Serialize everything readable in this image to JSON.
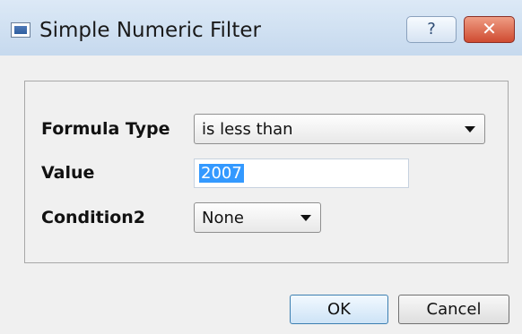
{
  "window": {
    "title": "Simple Numeric Filter"
  },
  "title_buttons": {
    "help": "?",
    "close": "✕"
  },
  "form": {
    "formula_type": {
      "label": "Formula Type",
      "value": "is less than"
    },
    "value": {
      "label": "Value",
      "value": "2007"
    },
    "condition2": {
      "label": "Condition2",
      "value": "None"
    }
  },
  "buttons": {
    "ok": "OK",
    "cancel": "Cancel"
  },
  "colors": {
    "titlebar": "#c6d9ee",
    "close_red": "#cf4b31",
    "selection": "#3399ff"
  },
  "icons": [
    "app-window-icon",
    "help-icon",
    "close-icon",
    "chevron-down-icon"
  ]
}
